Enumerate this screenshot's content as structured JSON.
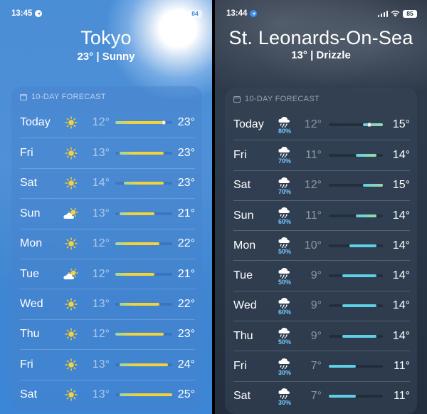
{
  "left": {
    "status": {
      "time": "13:45",
      "battery": "84"
    },
    "city": "Tokyo",
    "condition": "23° | Sunny",
    "forecast_header": "10-DAY FORECAST",
    "range": {
      "min": 12,
      "max": 25
    },
    "days": [
      {
        "day": "Today",
        "icon": "sun-icon",
        "low": "12°",
        "high": "23°",
        "lo": 12,
        "hi": 23,
        "current": 23
      },
      {
        "day": "Fri",
        "icon": "sun-icon",
        "low": "13°",
        "high": "23°",
        "lo": 13,
        "hi": 23
      },
      {
        "day": "Sat",
        "icon": "sun-icon",
        "low": "14°",
        "high": "23°",
        "lo": 14,
        "hi": 23
      },
      {
        "day": "Sun",
        "icon": "partly-cloudy-icon",
        "low": "13°",
        "high": "21°",
        "lo": 13,
        "hi": 21
      },
      {
        "day": "Mon",
        "icon": "sun-icon",
        "low": "12°",
        "high": "22°",
        "lo": 12,
        "hi": 22
      },
      {
        "day": "Tue",
        "icon": "partly-cloudy-icon",
        "low": "12°",
        "high": "21°",
        "lo": 12,
        "hi": 21
      },
      {
        "day": "Wed",
        "icon": "sun-icon",
        "low": "13°",
        "high": "22°",
        "lo": 13,
        "hi": 22
      },
      {
        "day": "Thu",
        "icon": "sun-icon",
        "low": "12°",
        "high": "23°",
        "lo": 12,
        "hi": 23
      },
      {
        "day": "Fri",
        "icon": "sun-icon",
        "low": "13°",
        "high": "24°",
        "lo": 13,
        "hi": 24
      },
      {
        "day": "Sat",
        "icon": "sun-icon",
        "low": "13°",
        "high": "25°",
        "lo": 13,
        "hi": 25
      }
    ]
  },
  "right": {
    "status": {
      "time": "13:44",
      "battery": "85"
    },
    "city": "St. Leonards-On-Sea",
    "condition": "13° | Drizzle",
    "forecast_header": "10-DAY FORECAST",
    "range": {
      "min": 7,
      "max": 15
    },
    "days": [
      {
        "day": "Today",
        "icon": "rain-icon",
        "precip": "80%",
        "low": "12°",
        "high": "15°",
        "lo": 12,
        "hi": 15,
        "current": 13
      },
      {
        "day": "Fri",
        "icon": "rain-icon",
        "precip": "70%",
        "low": "11°",
        "high": "14°",
        "lo": 11,
        "hi": 14
      },
      {
        "day": "Sat",
        "icon": "rain-icon",
        "precip": "70%",
        "low": "12°",
        "high": "15°",
        "lo": 12,
        "hi": 15
      },
      {
        "day": "Sun",
        "icon": "rain-icon",
        "precip": "60%",
        "low": "11°",
        "high": "14°",
        "lo": 11,
        "hi": 14
      },
      {
        "day": "Mon",
        "icon": "rain-icon",
        "precip": "50%",
        "low": "10°",
        "high": "14°",
        "lo": 10,
        "hi": 14
      },
      {
        "day": "Tue",
        "icon": "rain-icon",
        "precip": "50%",
        "low": "9°",
        "high": "14°",
        "lo": 9,
        "hi": 14
      },
      {
        "day": "Wed",
        "icon": "rain-icon",
        "precip": "60%",
        "low": "9°",
        "high": "14°",
        "lo": 9,
        "hi": 14
      },
      {
        "day": "Thu",
        "icon": "rain-icon",
        "precip": "50%",
        "low": "9°",
        "high": "14°",
        "lo": 9,
        "hi": 14
      },
      {
        "day": "Fri",
        "icon": "rain-icon",
        "precip": "30%",
        "low": "7°",
        "high": "11°",
        "lo": 7,
        "hi": 11
      },
      {
        "day": "Sat",
        "icon": "rain-icon",
        "precip": "30%",
        "low": "7°",
        "high": "11°",
        "lo": 7,
        "hi": 11
      }
    ]
  },
  "colors": {
    "warm": "#f2d33a",
    "mild": "#9ed9a0",
    "cool": "#5ed0e6",
    "precip": "#76c8ff"
  }
}
